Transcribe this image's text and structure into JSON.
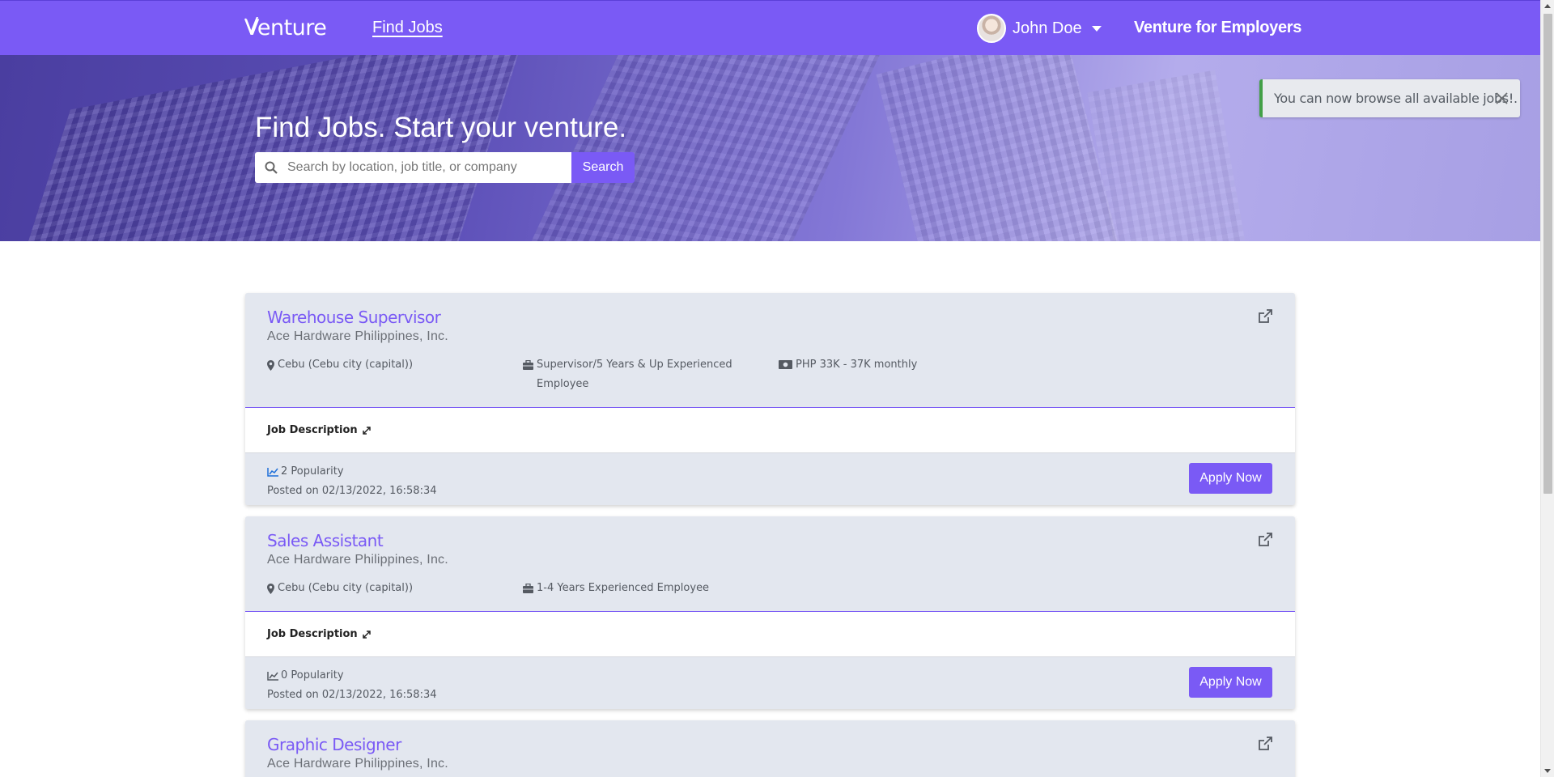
{
  "navbar": {
    "logo": "Venture",
    "find_jobs": "Find Jobs",
    "user_name": "John Doe",
    "employers_link": "Venture for Employers"
  },
  "hero": {
    "title": "Find Jobs. Start your venture.",
    "search_placeholder": "Search by location, job title, or company",
    "search_value": "",
    "search_button": "Search"
  },
  "toast": {
    "message": "You can now browse all available jobs!."
  },
  "jobs": [
    {
      "title": "Warehouse Supervisor",
      "company": "Ace Hardware Philippines, Inc.",
      "location": "Cebu (Cebu city (capital))",
      "experience": "Supervisor/5 Years & Up Experienced Employee",
      "salary": "PHP 33K - 37K monthly",
      "description_label": "Job Description",
      "popularity": "2 Popularity",
      "posted": "Posted on 02/13/2022, 16:58:34",
      "apply_label": "Apply Now"
    },
    {
      "title": "Sales Assistant",
      "company": "Ace Hardware Philippines, Inc.",
      "location": "Cebu (Cebu city (capital))",
      "experience": "1-4 Years Experienced Employee",
      "description_label": "Job Description",
      "popularity": "0 Popularity",
      "posted": "Posted on 02/13/2022, 16:58:34",
      "apply_label": "Apply Now"
    },
    {
      "title": "Graphic Designer",
      "company": "Ace Hardware Philippines, Inc."
    }
  ],
  "colors": {
    "brand": "#7a5af5",
    "card_bg": "#e3e7ef",
    "toast_accent": "#43a047",
    "popularity_active": "#1e6fd9"
  }
}
